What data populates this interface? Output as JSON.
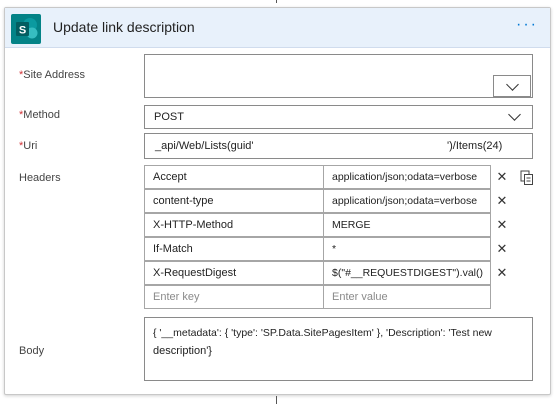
{
  "card": {
    "title": "Update link description",
    "menu_label": "···"
  },
  "fields": {
    "site_address": {
      "required_mark": "*",
      "label": "Site Address",
      "value": ""
    },
    "method": {
      "required_mark": "*",
      "label": "Method",
      "value": "POST"
    },
    "uri": {
      "required_mark": "*",
      "label": "Uri",
      "value_prefix": "_api/Web/Lists(guid'",
      "value_suffix": "')/Items(24)"
    },
    "headers": {
      "label": "Headers",
      "rows": [
        {
          "key": "Accept",
          "value": "application/json;odata=verbose"
        },
        {
          "key": "content-type",
          "value": "application/json;odata=verbose"
        },
        {
          "key": "X-HTTP-Method",
          "value": "MERGE"
        },
        {
          "key": "If-Match",
          "value": "*"
        },
        {
          "key": "X-RequestDigest",
          "value": "$(\"#__REQUESTDIGEST\").val()"
        }
      ],
      "new_key_placeholder": "Enter key",
      "new_value_placeholder": "Enter value",
      "remove_symbol": "✕"
    },
    "body": {
      "label": "Body",
      "value_line1": "{ '__metadata': { 'type': 'SP.Data.SitePagesItem' }, 'Description': 'Test new",
      "value_line2": "description'}"
    }
  },
  "colors": {
    "header_bg": "#e8f1fb",
    "sharepoint_teal": "#038387",
    "accent_blue": "#0078d4",
    "required_red": "#d13438"
  }
}
